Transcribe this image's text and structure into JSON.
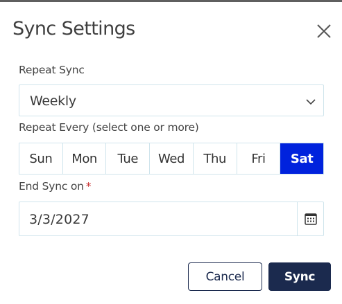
{
  "dialog": {
    "title": "Sync Settings"
  },
  "repeat_sync": {
    "label": "Repeat Sync",
    "value": "Weekly"
  },
  "repeat_every": {
    "label": "Repeat Every (select one or more)",
    "days": [
      {
        "label": "Sun",
        "selected": false
      },
      {
        "label": "Mon",
        "selected": false
      },
      {
        "label": "Tue",
        "selected": false
      },
      {
        "label": "Wed",
        "selected": false
      },
      {
        "label": "Thu",
        "selected": false
      },
      {
        "label": "Fri",
        "selected": false
      },
      {
        "label": "Sat",
        "selected": true
      }
    ]
  },
  "end_sync": {
    "label": "End Sync on",
    "required_marker": "*",
    "value": "3/3/2027"
  },
  "actions": {
    "cancel_label": "Cancel",
    "sync_label": "Sync"
  },
  "colors": {
    "selected_day": "#0022dd",
    "primary_button": "#1b2a4e",
    "required": "#c62828",
    "border": "#cfe4ec"
  },
  "icons": {
    "close": "close-icon",
    "dropdown": "chevron-down-icon",
    "calendar": "calendar-icon"
  }
}
